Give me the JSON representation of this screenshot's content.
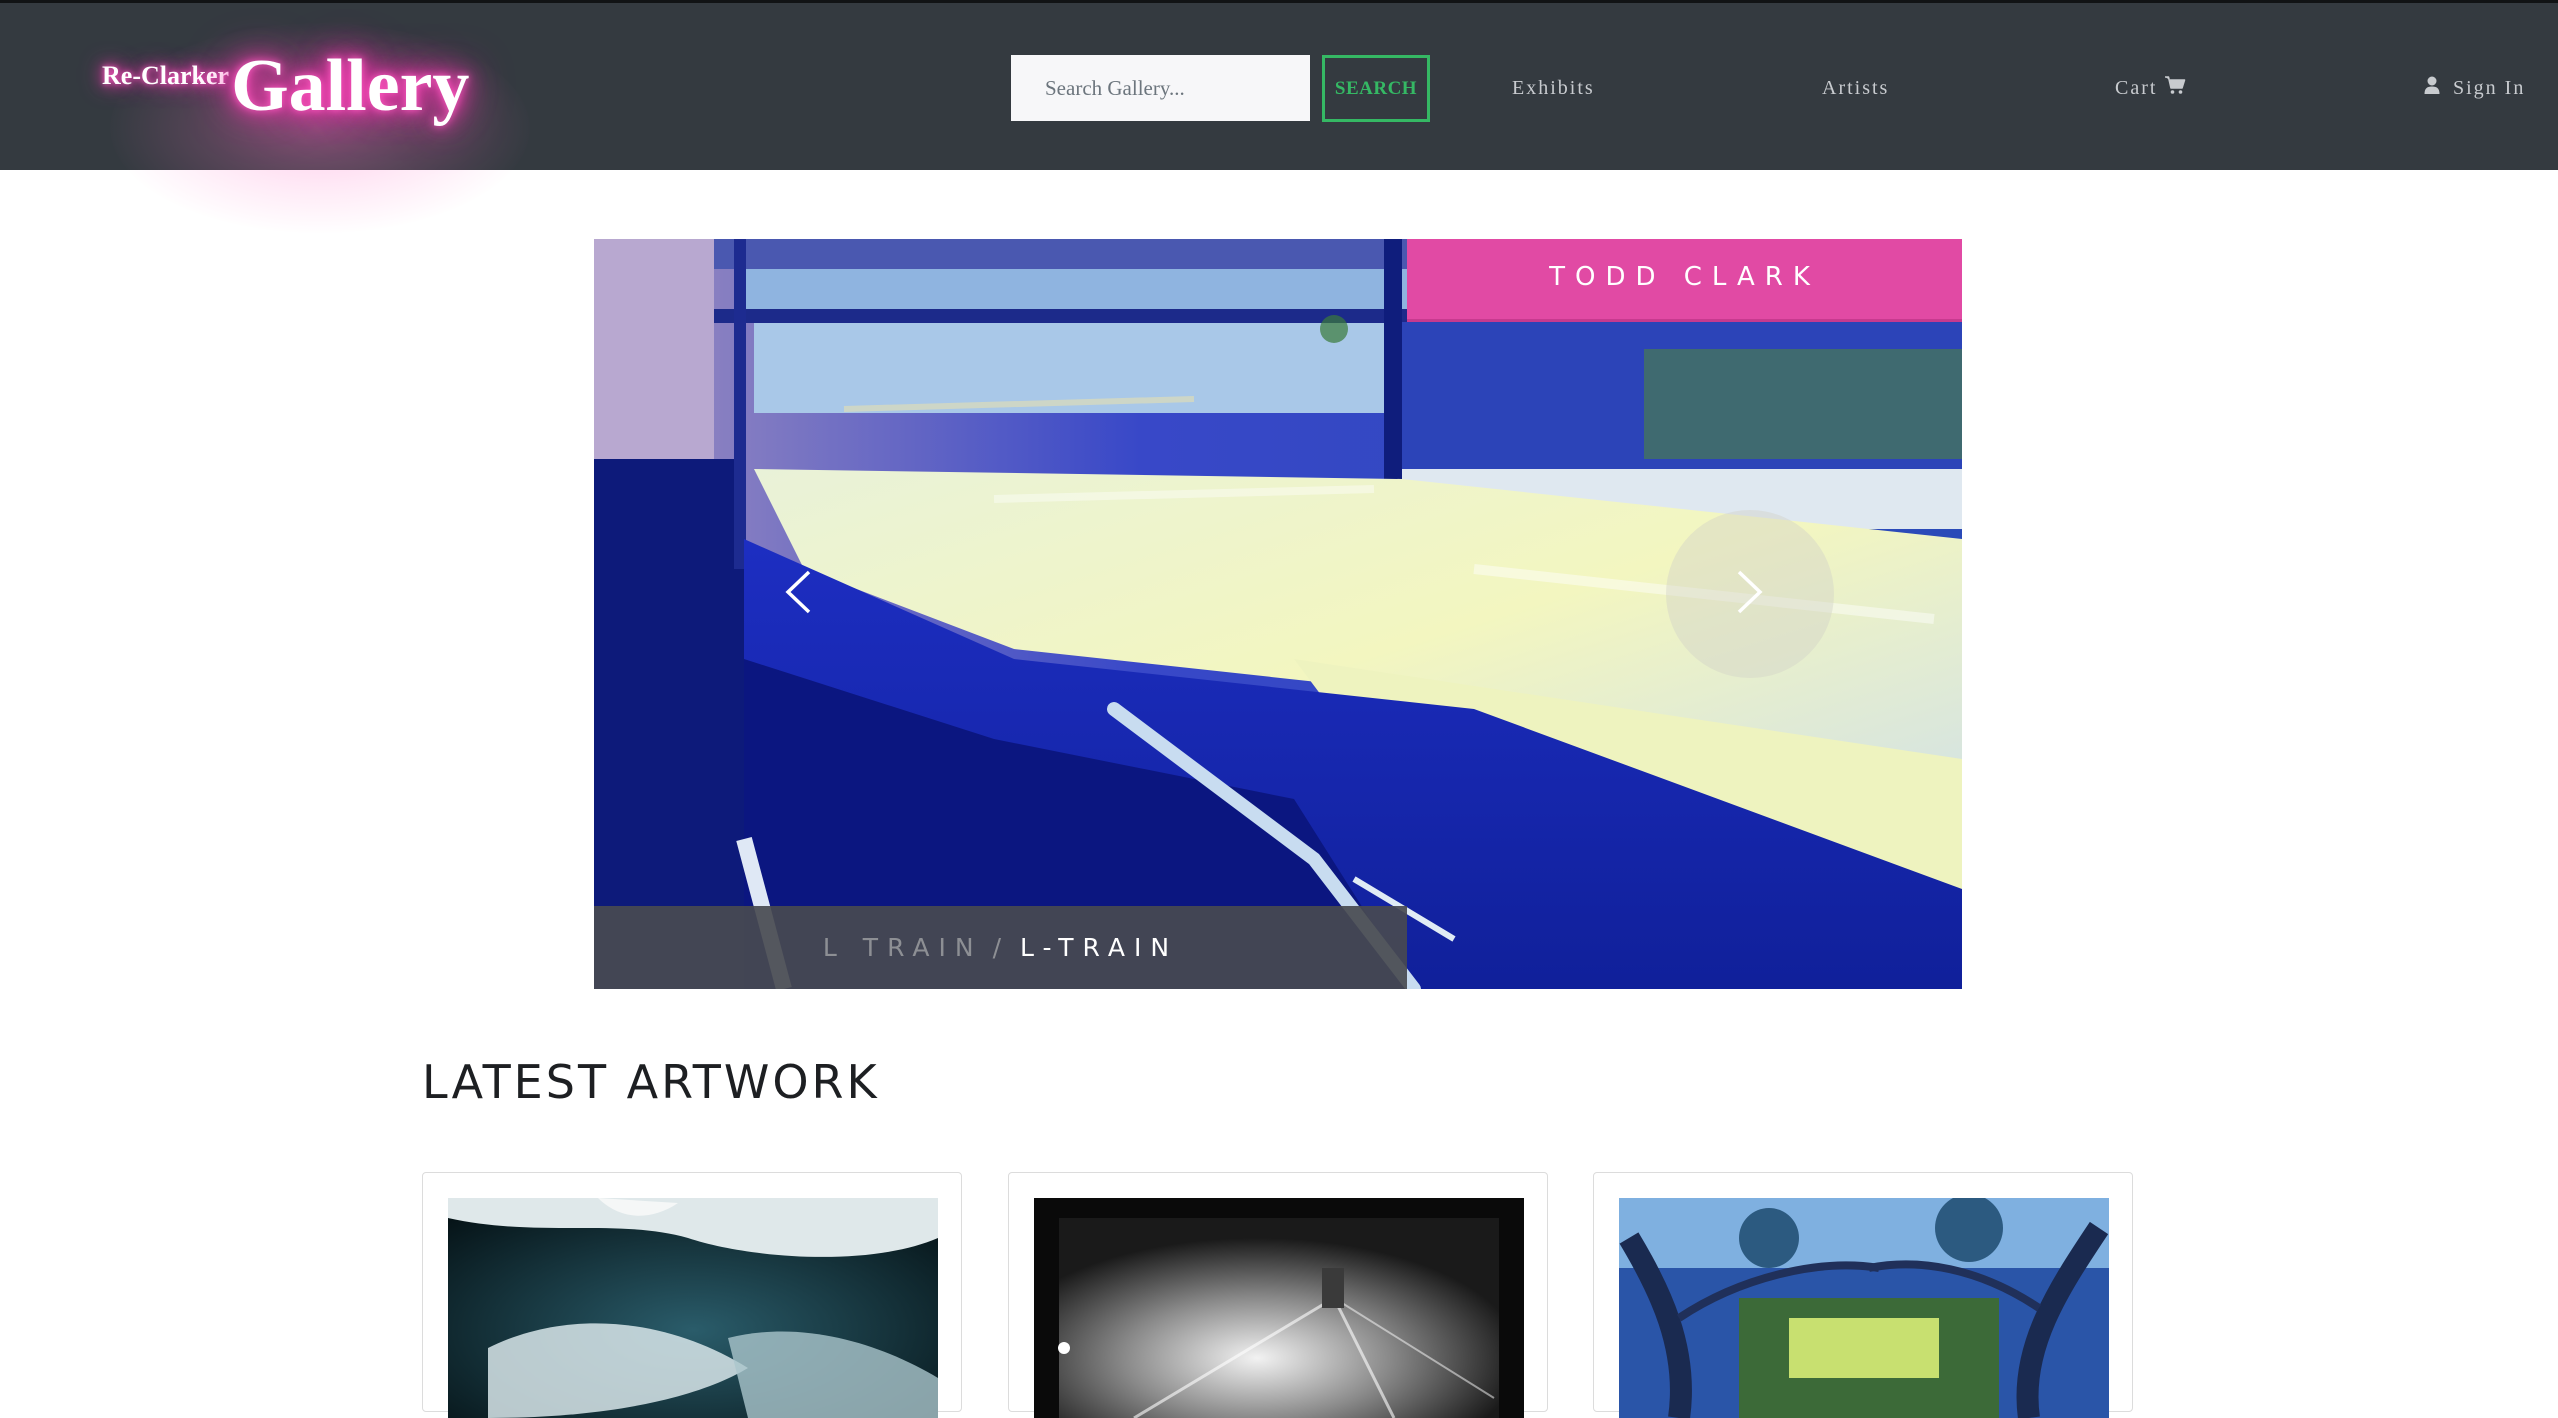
{
  "navbar": {
    "logo_small": "Re-Clarker",
    "logo_big": "Gallery",
    "search_placeholder": "Search Gallery...",
    "search_label": "SEARCH",
    "links": {
      "exhibits": "Exhibits",
      "artists": "Artists",
      "cart": "Cart",
      "sign_in": "Sign In"
    },
    "icons": {
      "cart": "cart-icon",
      "sign_in": "user-icon"
    }
  },
  "carousel": {
    "artist": "TODD CLARK",
    "caption_muted": "L TRAIN",
    "caption_separator": "/",
    "caption_title": "L-TRAIN",
    "prev_icon": "chevron-left-icon",
    "next_icon": "chevron-right-icon"
  },
  "latest": {
    "title": "LATEST ARTWORK"
  },
  "colors": {
    "navbar_bg": "#343a40",
    "search_accent": "#35b864",
    "artist_banner": "#e14aa4",
    "logo_glow": "#ff3bb5"
  }
}
